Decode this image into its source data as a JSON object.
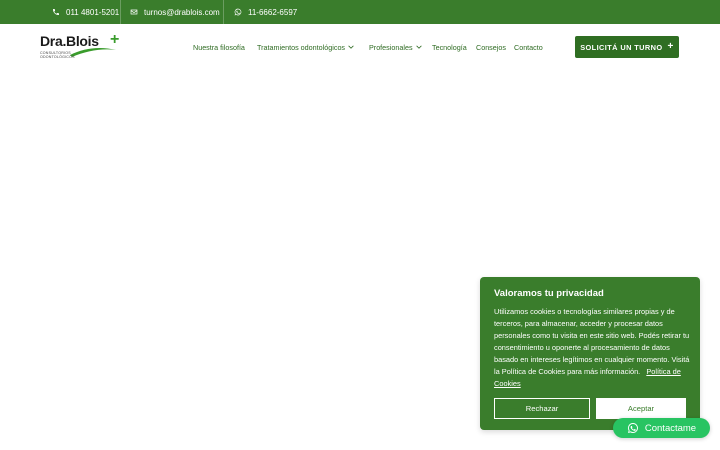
{
  "topbar": {
    "phone": "011 4801-5201",
    "email": "turnos@drablois.com",
    "whatsapp": "11-6662-6597"
  },
  "logo": {
    "name": "Dra.Blois",
    "plus": "+",
    "subtitle_line1": "CONSULTORIOS",
    "subtitle_line2": "ODONTOLÓGICOS"
  },
  "nav": {
    "items": [
      {
        "label": "Nuestra filosofía",
        "dropdown": false
      },
      {
        "label": "Tratamientos odontológicos",
        "dropdown": true
      },
      {
        "label": "Profesionales",
        "dropdown": true
      },
      {
        "label": "Tecnología",
        "dropdown": false
      },
      {
        "label": "Consejos",
        "dropdown": false
      },
      {
        "label": "Contacto",
        "dropdown": false
      }
    ],
    "cta_label": "SOLICITÁ UN TURNO",
    "cta_icon": "+"
  },
  "cookie_banner": {
    "title": "Valoramos tu privacidad",
    "text": "Utilizamos cookies o tecnologías similares propias y de terceros, para almacenar, acceder y procesar datos personales como tu visita en este sitio web. Podés retirar tu consentimiento u oponerte al procesamiento de datos basado en intereses legítimos en cualquier momento. Visitá la Política de Cookies para más información.",
    "link_label": "Política de Cookies",
    "reject_label": "Rechazar",
    "accept_label": "Aceptar"
  },
  "whatsapp_button": {
    "label": "Contactame"
  },
  "colors": {
    "brand_green": "#3a7d2c",
    "cta_green": "#2f6e22",
    "whatsapp_green": "#28c462"
  },
  "icons": {
    "phone": "phone-icon",
    "email": "envelope-icon",
    "whatsapp": "whatsapp-icon",
    "chevron": "chevron-down-icon"
  }
}
